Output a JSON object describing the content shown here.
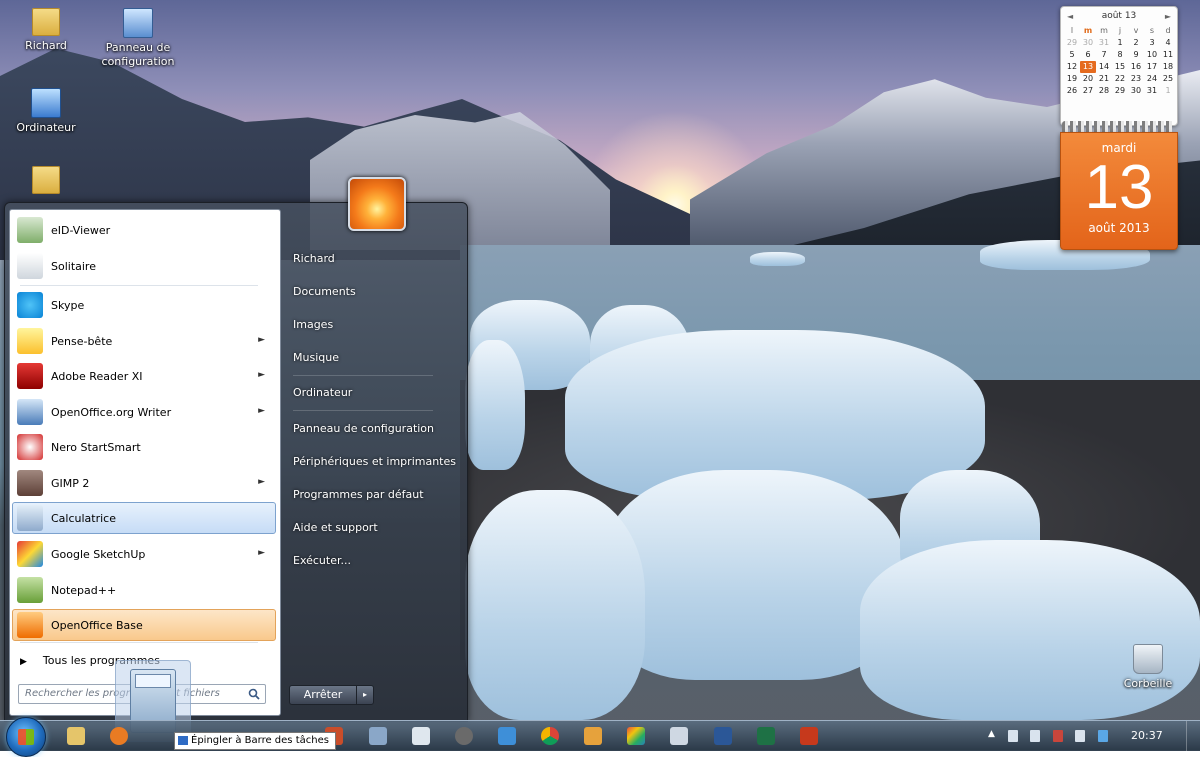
{
  "desktop": {
    "icons": {
      "user_folder": "Richard",
      "control_panel": "Panneau de configuration",
      "computer": "Ordinateur",
      "folder": "",
      "recycle_bin": "Corbeille"
    }
  },
  "calendar": {
    "month_short": "août 13",
    "prev": "◄",
    "next": "►",
    "weekday_heads": [
      "l",
      "m",
      "m",
      "j",
      "v",
      "s",
      "d"
    ],
    "rows": [
      [
        "29",
        "30",
        "31",
        "1",
        "2",
        "3",
        "4"
      ],
      [
        "5",
        "6",
        "7",
        "8",
        "9",
        "10",
        "11"
      ],
      [
        "12",
        "13",
        "14",
        "15",
        "16",
        "17",
        "18"
      ],
      [
        "19",
        "20",
        "21",
        "22",
        "23",
        "24",
        "25"
      ],
      [
        "26",
        "27",
        "28",
        "29",
        "30",
        "31",
        "1"
      ]
    ],
    "weekday": "mardi",
    "day": "13",
    "month_year": "août 2013",
    "colors": {
      "accent": "#e56b1f"
    }
  },
  "start_menu": {
    "programs": [
      {
        "label": "eID-Viewer",
        "icon": "eid-card-icon",
        "has_submenu": false
      },
      {
        "label": "Solitaire",
        "icon": "cards-icon",
        "has_submenu": false
      },
      {
        "label": "Skype",
        "icon": "skype-icon",
        "has_submenu": false
      },
      {
        "label": "Pense-bête",
        "icon": "sticky-notes-icon",
        "has_submenu": true
      },
      {
        "label": "Adobe Reader XI",
        "icon": "adobe-reader-icon",
        "has_submenu": true
      },
      {
        "label": "OpenOffice.org Writer",
        "icon": "writer-icon",
        "has_submenu": true
      },
      {
        "label": "Nero StartSmart",
        "icon": "nero-icon",
        "has_submenu": false
      },
      {
        "label": "GIMP 2",
        "icon": "gimp-icon",
        "has_submenu": true
      },
      {
        "label": "Calculatrice",
        "icon": "calculator-icon",
        "has_submenu": false
      },
      {
        "label": "Google SketchUp",
        "icon": "sketchup-icon",
        "has_submenu": true
      },
      {
        "label": "Notepad++",
        "icon": "notepadpp-icon",
        "has_submenu": false
      },
      {
        "label": "OpenOffice Base",
        "icon": "base-icon",
        "has_submenu": false
      }
    ],
    "submenu_arrow": "►",
    "all_programs": "Tous les programmes",
    "all_programs_arrow": "▶",
    "search_placeholder": "Rechercher les programmes et fichiers",
    "right_items": [
      "Richard",
      "Documents",
      "Images",
      "Musique",
      "Ordinateur",
      "Panneau de configuration",
      "Périphériques et imprimantes",
      "Programmes par défaut",
      "Aide et support",
      "Exécuter..."
    ],
    "shutdown_label": "Arrêter",
    "shutdown_arrow": "▸"
  },
  "tooltip": {
    "text": "Épingler à Barre des tâches"
  },
  "taskbar": {
    "clock": "20:37"
  }
}
